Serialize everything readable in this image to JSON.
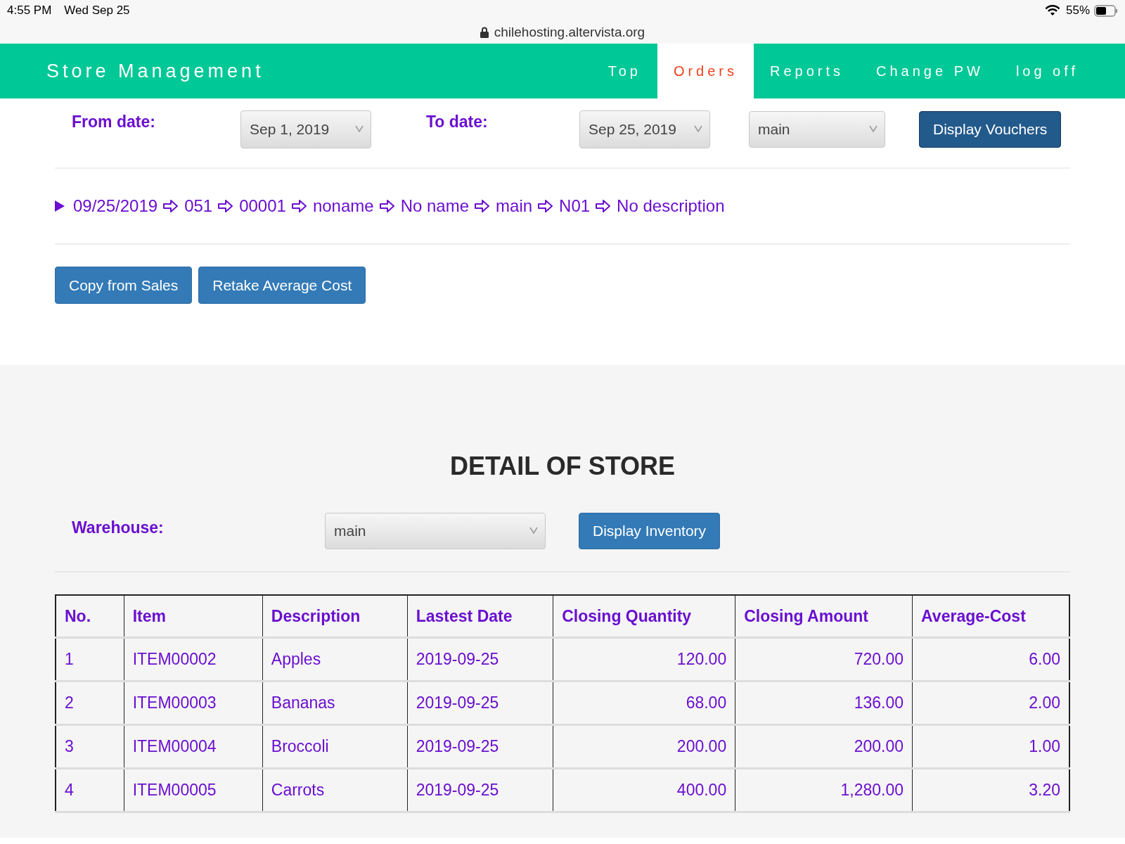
{
  "status_bar": {
    "time": "4:55 PM",
    "date": "Wed Sep 25",
    "battery": "55%"
  },
  "address_bar": {
    "url": "chilehosting.altervista.org"
  },
  "nav": {
    "brand": "Store Management",
    "tabs": [
      {
        "label": "Top",
        "selected": false
      },
      {
        "label": "Orders",
        "selected": true
      },
      {
        "label": "Reports",
        "selected": false
      },
      {
        "label": "Change PW",
        "selected": false
      },
      {
        "label": "log off",
        "selected": false
      }
    ]
  },
  "filters": {
    "from_label": "From date:",
    "from_value": "Sep 1, 2019",
    "to_label": "To date:",
    "to_value": "Sep 25, 2019",
    "store_value": "main",
    "button": "Display Vouchers"
  },
  "voucher": {
    "expanded": false,
    "parts": [
      "09/25/2019",
      "051",
      "00001",
      "noname",
      "No name",
      "main",
      "N01",
      "No description"
    ]
  },
  "actions": [
    "Copy from Sales",
    "Retake Average Cost"
  ],
  "detail": {
    "title": "DETAIL OF STORE",
    "warehouse_label": "Warehouse:",
    "warehouse_value": "main",
    "button": "Display Inventory"
  },
  "table": {
    "columns": [
      {
        "label": "No.",
        "kind": "text"
      },
      {
        "label": "Item",
        "kind": "text"
      },
      {
        "label": "Description",
        "kind": "text"
      },
      {
        "label": "Lastest Date",
        "kind": "text"
      },
      {
        "label": "Closing Quantity",
        "kind": "number"
      },
      {
        "label": "Closing Amount",
        "kind": "number"
      },
      {
        "label": "Average-Cost",
        "kind": "number"
      }
    ],
    "rows": [
      [
        "1",
        "ITEM00002",
        "Apples",
        "2019-09-25",
        "120.00",
        "720.00",
        "6.00"
      ],
      [
        "2",
        "ITEM00003",
        "Bananas",
        "2019-09-25",
        "68.00",
        "136.00",
        "2.00"
      ],
      [
        "3",
        "ITEM00004",
        "Broccoli",
        "2019-09-25",
        "200.00",
        "200.00",
        "1.00"
      ],
      [
        "4",
        "ITEM00005",
        "Carrots",
        "2019-09-25",
        "400.00",
        "1,280.00",
        "3.20"
      ]
    ]
  }
}
